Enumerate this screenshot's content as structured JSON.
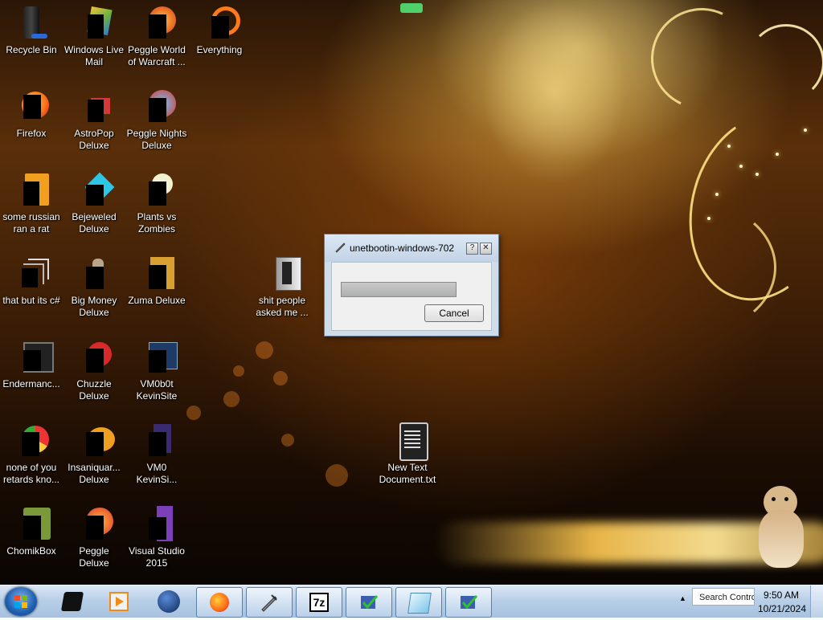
{
  "desktop_icons": [
    {
      "label": "Recycle Bin",
      "icon": "recycle-bin-icon"
    },
    {
      "label": "Windows Live Mail",
      "icon": "mail-icon"
    },
    {
      "label": "Peggle World of Warcraft ...",
      "icon": "peggle-icon"
    },
    {
      "label": "Everything",
      "icon": "search-ring-icon"
    },
    {
      "label": "Firefox",
      "icon": "firefox-icon"
    },
    {
      "label": "AstroPop Deluxe",
      "icon": "astropop-icon"
    },
    {
      "label": "Peggle Nights Deluxe",
      "icon": "peggle-nights-icon"
    },
    {
      "label": "some russian ran a rat",
      "icon": "orange-app-icon"
    },
    {
      "label": "Bejeweled Deluxe",
      "icon": "gem-icon"
    },
    {
      "label": "Plants vs Zombies",
      "icon": "plants-icon"
    },
    {
      "label": "that but its c#",
      "icon": "shortcut-icon"
    },
    {
      "label": "Big Money Deluxe",
      "icon": "money-icon"
    },
    {
      "label": "Zuma Deluxe",
      "icon": "zuma-icon"
    },
    {
      "label": "Endermanc...",
      "icon": "terminal-icon"
    },
    {
      "label": "Chuzzle Deluxe",
      "icon": "chuzzle-icon"
    },
    {
      "label": "VM0b0t KevinSite",
      "icon": "vm-icon"
    },
    {
      "label": "none of you retards kno...",
      "icon": "chrome-icon"
    },
    {
      "label": "Insaniquar... Deluxe",
      "icon": "fish-icon"
    },
    {
      "label": "VM0 KevinSi...",
      "icon": "file-icon"
    },
    {
      "label": "ChomikBox",
      "icon": "hamster-box-icon"
    },
    {
      "label": "Peggle Deluxe",
      "icon": "peggle-deluxe-icon"
    },
    {
      "label": "Visual Studio 2015",
      "icon": "visual-studio-icon"
    },
    {
      "label": "shit people asked me ...",
      "icon": "folder-icon"
    },
    {
      "label": "New Text Document.txt",
      "icon": "text-file-icon"
    }
  ],
  "dialog": {
    "title": "unetbootin-windows-702",
    "help_glyph": "?",
    "close_glyph": "✕",
    "cancel_label": "Cancel",
    "progress_fraction": 1.0
  },
  "taskbar": {
    "items": [
      {
        "icon": "black-device-icon"
      },
      {
        "icon": "media-player-icon"
      },
      {
        "icon": "globe-icon"
      },
      {
        "icon": "firefox-icon"
      },
      {
        "icon": "unetbootin-icon"
      },
      {
        "icon": "7zip-icon",
        "text": "7z"
      },
      {
        "icon": "installer-check-icon"
      },
      {
        "icon": "notepad-icon"
      },
      {
        "icon": "installer-check-icon"
      }
    ],
    "tray_arrow": "▲",
    "search_text": "Search Contro",
    "time": "9:50 AM",
    "date": "10/21/2024"
  }
}
